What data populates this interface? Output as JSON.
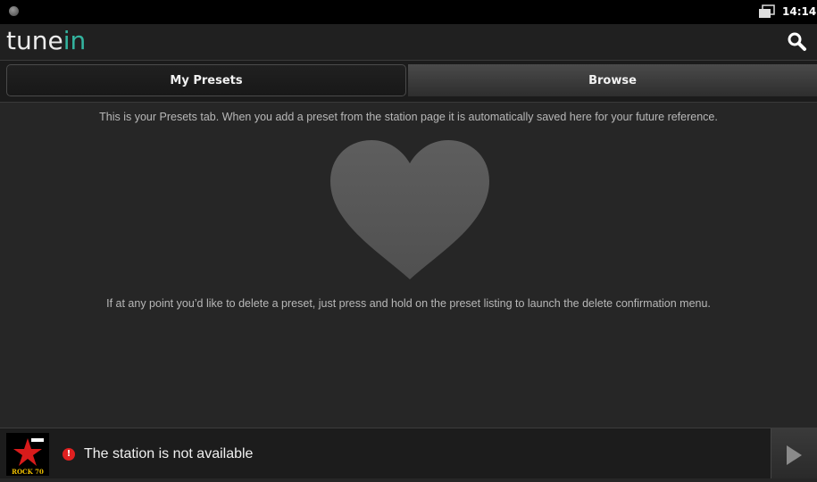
{
  "status_bar": {
    "time": "14:14",
    "left_icon": "status-dot-icon",
    "network_icon": "network-icon"
  },
  "app_bar": {
    "logo_part1": "tune",
    "logo_part2": "in",
    "search_icon": "search-icon",
    "logo_color_accent": "#33b5a0"
  },
  "tabs": [
    {
      "label": "My Presets",
      "active": true
    },
    {
      "label": "Browse",
      "active": false
    }
  ],
  "presets": {
    "intro_text": "This is your Presets tab. When you add a preset from the station page it is automatically saved here for your future reference.",
    "heart_icon": "heart-icon",
    "delete_hint": "If at any point you’d like to delete a preset, just press and hold on the preset listing to launch the delete confirmation menu."
  },
  "player": {
    "station_logo_text": "ROCK 70",
    "alert_symbol": "!",
    "status_text": "The station is not available",
    "play_icon": "play-icon",
    "alert_color": "#e02020"
  }
}
